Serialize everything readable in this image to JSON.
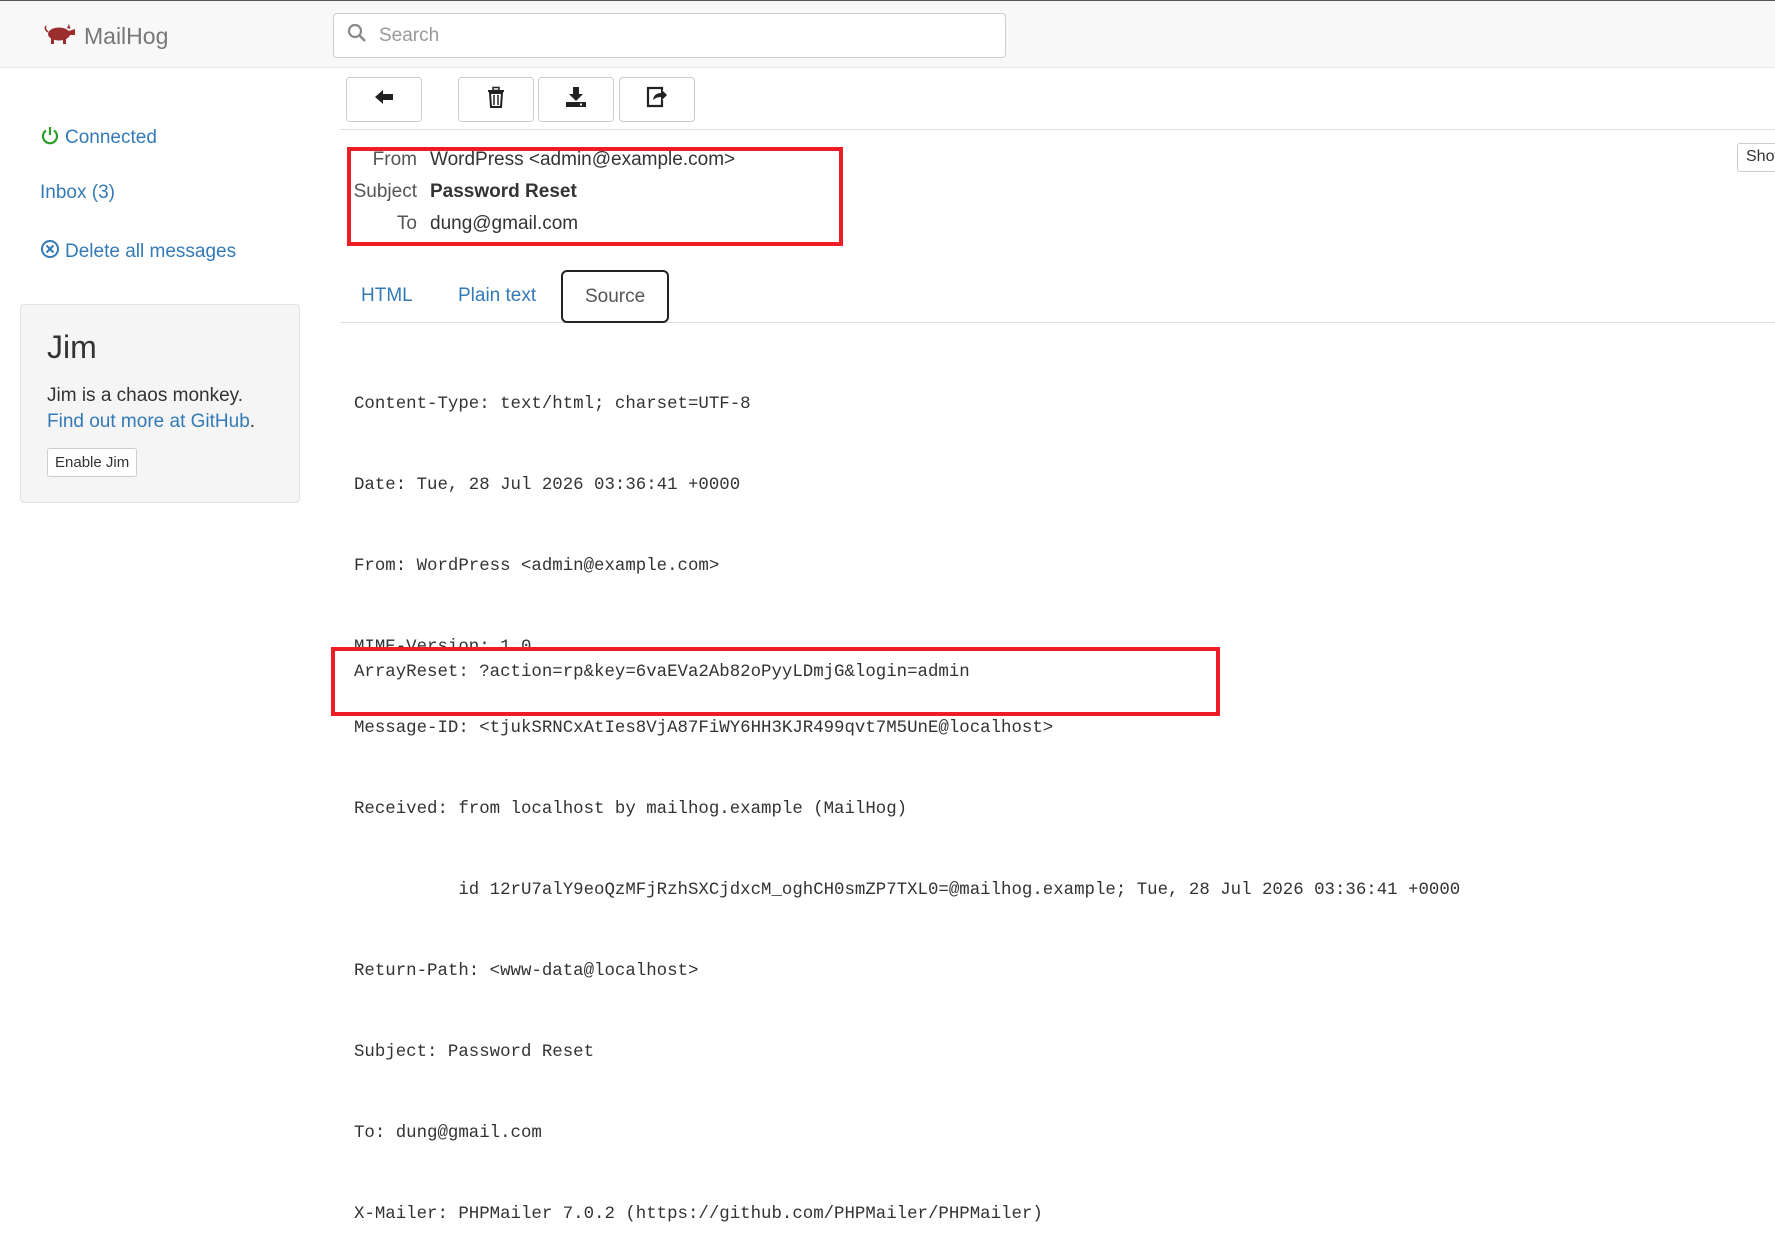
{
  "app": {
    "name": "MailHog"
  },
  "search": {
    "placeholder": "Search"
  },
  "sidebar": {
    "connected": "Connected",
    "inbox": "Inbox (3)",
    "delete_all": "Delete all messages"
  },
  "jim": {
    "title": "Jim",
    "description": "Jim is a chaos monkey.",
    "link": "Find out more at GitHub",
    "link_suffix": ".",
    "button": "Enable Jim"
  },
  "toolbar": {
    "back_icon": "arrow-left-icon",
    "delete_icon": "trash-icon",
    "download_icon": "download-icon",
    "release_icon": "share-icon",
    "show_label": "Show"
  },
  "message": {
    "headers": [
      {
        "label": "From",
        "value": "WordPress <admin@example.com>"
      },
      {
        "label": "Subject",
        "value": "Password Reset"
      },
      {
        "label": "To",
        "value": "dung@gmail.com"
      }
    ],
    "tabs": [
      "HTML",
      "Plain text",
      "Source"
    ],
    "active_tab": "Source",
    "source_lines": [
      "Content-Type: text/html; charset=UTF-8",
      "Date: Tue, 28 Jul 2026 03:36:41 +0000",
      "From: WordPress <admin@example.com>",
      "MIME-Version: 1.0",
      "Message-ID: <tjukSRNCxAtIes8VjA87FiWY6HH3KJR499qvt7M5UnE@localhost>",
      "Received: from localhost by mailhog.example (MailHog)",
      "          id 12rU7alY9eoQzMFjRzhSXCjdxcM_oghCH0smZP7TXL0=@mailhog.example; Tue, 28 Jul 2026 03:36:41 +0000",
      "Return-Path: <www-data@localhost>",
      "Subject: Password Reset",
      "To: dung@gmail.com",
      "X-Mailer: PHPMailer 7.0.2 (https://github.com/PHPMailer/PHPMailer)"
    ],
    "body": "ArrayReset: ?action=rp&key=6vaEVa2Ab82oPyyLDmjG&login=admin"
  },
  "colors": {
    "link": "#337ab7",
    "connected": "#2a9d2a",
    "highlight": "#ee1c24",
    "logo": "#9b2d2d"
  }
}
